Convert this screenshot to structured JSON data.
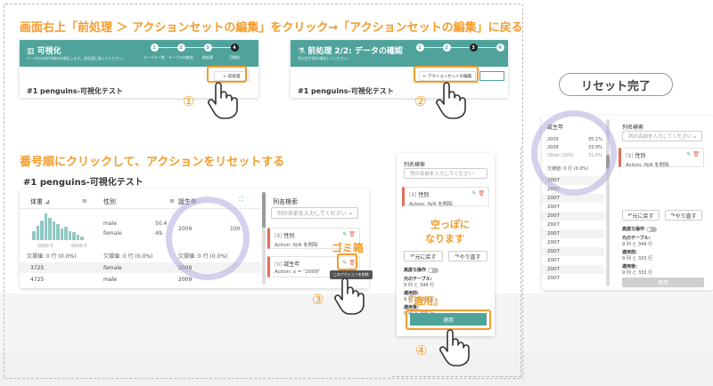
{
  "headings": {
    "top": "画面右上「前処理 ＞ アクションセットの編集」をクリック→「アクションセットの編集」に戻る",
    "middle": "番号順にクリックして、アクションをリセットする"
  },
  "panel1": {
    "title": "可視化",
    "subtitle": "データの分布や傾向を確認します。前処理に進んでください。",
    "steps": [
      {
        "num": "1",
        "label": "テーブル一覧"
      },
      {
        "num": "2",
        "label": "テーブルの結合"
      },
      {
        "num": "3",
        "label": "前処理"
      },
      {
        "num": "4",
        "label": "可視化"
      }
    ],
    "button": "← 前処理",
    "doc_title": "#1 penguins-可視化テスト",
    "callout": "①"
  },
  "panel2": {
    "title": "前処理 2/2: データの確認",
    "subtitle": "列の型や値を確認してください。",
    "button": "← アクションセットの編集",
    "button2": "可視化へ",
    "doc_title": "#1 penguins-可視化テスト",
    "callout": "②"
  },
  "reset_done": "リセット完了",
  "table": {
    "doc_title": "#1 penguins-可視化テスト",
    "headers": {
      "col1": "体重",
      "col2": "性別",
      "col3": "誕生年"
    },
    "hist_min": "2900.0",
    "hist_max": "6000.0",
    "hist_heights": [
      0.35,
      0.55,
      0.75,
      1.0,
      0.85,
      0.7,
      0.6,
      0.45,
      0.5,
      0.35,
      0.3,
      0.2,
      0.15
    ],
    "sex_values": [
      {
        "label": "male",
        "pct": "50.4"
      },
      {
        "label": "female",
        "pct": "49."
      }
    ],
    "year_values": [
      {
        "label": "2009",
        "pct": "100."
      }
    ],
    "missing": "欠損値: 0 行 (0.0%)",
    "rows": [
      {
        "weight": "3725",
        "sex": "female",
        "year": "2009"
      },
      {
        "weight": "4725",
        "sex": "male",
        "year": "2009"
      }
    ]
  },
  "actions_panel": {
    "search_label": "列名検索",
    "search_placeholder": "列の名前を入力してください",
    "action1_idx": "[8]",
    "action1_title": "性別",
    "action1_desc": "Action: N/A を削除",
    "action2_idx": "[9]",
    "action2_title": "誕生年",
    "action2_desc": "Action: x = \"2009\"",
    "tooltip": "このアクションを削除",
    "gomi_label": "ゴミ箱",
    "callout3": "③"
  },
  "middle_panel": {
    "search_label": "列名検索",
    "search_placeholder": "列の名前を入力してください",
    "action_idx": "[8]",
    "action_title": "性別",
    "action_desc": "Action: N/A を削除",
    "empty_note_line1": "空っぽに",
    "empty_note_line2": "なります",
    "undo": "元に戻す",
    "redo": "やり直す",
    "advanced": "高度な操作",
    "orig_table_label": "元のテーブル:",
    "orig_table_value": "9 列 と 344 行",
    "applied_label": "適用前:",
    "applied_value": "9 列 と 117 行",
    "after_label": "適用後:",
    "after_value": "9 列 と 333 行",
    "apply": "適用",
    "apply_note": "『適用』",
    "callout4": "④"
  },
  "right_panel": {
    "col_header": "誕生年",
    "values": [
      {
        "label": "2009",
        "pct": "35.1%"
      },
      {
        "label": "2008",
        "pct": "33.9%"
      },
      {
        "label": "Other (103)",
        "pct": "31.0%"
      }
    ],
    "missing": "欠損値: 0 行 (0.0%)",
    "rows": [
      "2007",
      "2007",
      "2007",
      "2007",
      "2007",
      "2007",
      "2007",
      "2007",
      "2007",
      "2007",
      "2007",
      "2007"
    ],
    "search_label": "列名検索",
    "search_placeholder": "列の名前を入力してください",
    "action_idx": "[8]",
    "action_title": "性別",
    "action_desc": "Action: N/A を削除",
    "undo": "元に戻す",
    "redo": "やり直す",
    "advanced": "高度な操作",
    "orig_table_label": "元のテーブル:",
    "orig_table_value": "9 列 と 344 行",
    "applied_label": "適用前:",
    "applied_value": "9 列 と 333 行",
    "after_label": "適用後:",
    "after_value": "9 列 と 333 行",
    "apply": "適用"
  },
  "colors": {
    "teal": "#4fa39b",
    "orange": "#f39c2b",
    "red_accent": "#e26d5c",
    "highlight_circle": "#b4aadc"
  }
}
